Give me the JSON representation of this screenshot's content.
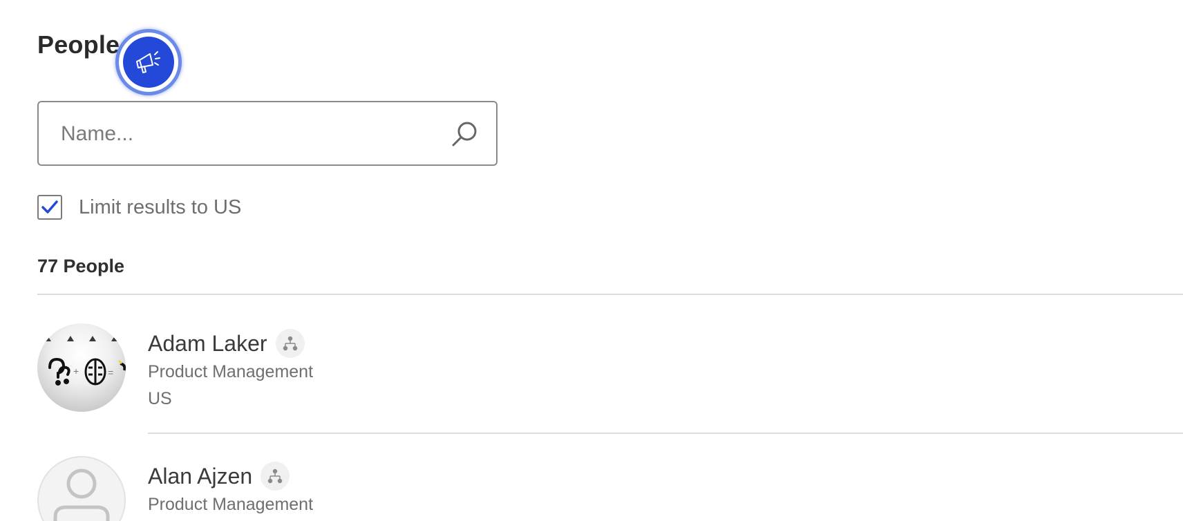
{
  "header": {
    "title": "People"
  },
  "announcement_button": {
    "icon": "megaphone-icon",
    "color": "#2448d8",
    "ring_color": "#6a8ae8"
  },
  "search": {
    "placeholder": "Name...",
    "value": "",
    "icon": "search-icon"
  },
  "filter": {
    "limit_label": "Limit results to US",
    "checked": true,
    "check_color": "#2448d8"
  },
  "results": {
    "count_label": "77 People"
  },
  "people": [
    {
      "name": "Adam Laker",
      "department": "Product Management",
      "location": "US",
      "avatar": "photo",
      "org_icon": "org-chart-icon"
    },
    {
      "name": "Alan Ajzen",
      "department": "Product Management",
      "location": "",
      "avatar": "placeholder-person-icon",
      "org_icon": "org-chart-icon"
    }
  ]
}
